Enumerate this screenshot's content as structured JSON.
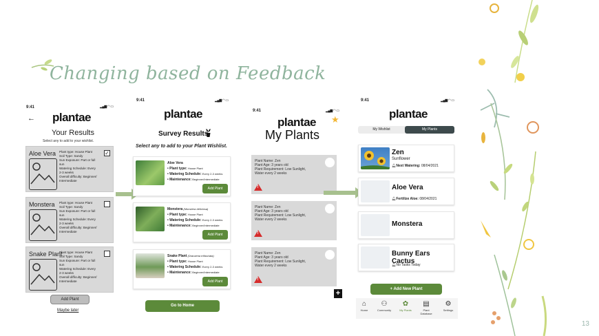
{
  "slide": {
    "title": "Changing based on Feedback",
    "page_number": "13"
  },
  "screen1": {
    "time": "9:41",
    "logo": "plantae",
    "heading": "Your Results",
    "subheading": "Select any to add to your wishlist.",
    "cards": [
      {
        "name": "Aloe Vera",
        "lines": [
          "Plant type: House Plant",
          "Soil Type: Sandy",
          "Sun Exposure: Part or full",
          "sun",
          "Watering Schedule: Every",
          "2-3 weeks",
          "Overall difficulty: Beginner/",
          "Intermediate"
        ],
        "checked": "✓"
      },
      {
        "name": "Monstera",
        "lines": [
          "Plant type: House Plant",
          "Soil Type: Sandy",
          "Sun Exposure: Part or full",
          "sun",
          "Watering Schedule: Every",
          "2-3 weeks",
          "Overall difficulty: Beginner/",
          "Intermediate"
        ],
        "checked": ""
      },
      {
        "name": "Snake Plant",
        "lines": [
          "Plant type: House Plant",
          "Soil Type: Sandy",
          "Sun Exposure: Part or full",
          "sun",
          "Watering Schedule: Every",
          "2-3 weeks",
          "Overall difficulty: Beginner/",
          "Intermediate"
        ],
        "checked": ""
      }
    ],
    "add_button": "Add Plant",
    "later_link": "Maybe later"
  },
  "screen2": {
    "time": "9:41",
    "logo": "plantae",
    "heading": "Survey Results",
    "subheading": "Select any to add to your Plant Wishlist.",
    "cards": [
      {
        "name": "Aloe Vera",
        "sci": "",
        "type": "House Plant",
        "schedule": "Every 2-3 weeks",
        "maint": "Beginner/Intermediate",
        "button": "Add Plant"
      },
      {
        "name": "Monstera",
        "sci": "(Monstera deliciosa)",
        "type": "House Plant",
        "schedule": "Every 2-3 weeks",
        "maint": "Beginner/Intermediate",
        "button": "Add Plant"
      },
      {
        "name": "Snake Plant",
        "sci": "(Dracaena trifasciata)",
        "type": "House Plant",
        "schedule": "Every 2-3 weeks",
        "maint": "Beginner/Intermediate",
        "button": "Add Plant"
      }
    ],
    "labels": {
      "type": "• Plant type:",
      "schedule": "• Watering Schedule:",
      "maint": "• Maintenance:"
    },
    "home_button": "Go to Home"
  },
  "screen3": {
    "time": "9:41",
    "logo": "plantae",
    "heading": "My Plants",
    "plus": "+",
    "cards": [
      {
        "lines": [
          "Plant Name: Zen",
          "Plant Age: 3 years old",
          "Plant Requirement: Low Sunlight,",
          "Water every 2 weeks"
        ]
      },
      {
        "lines": [
          "Plant Name: Zen",
          "Plant Age: 3 years old",
          "Plant Requirement: Low Sunlight,",
          "Water every 2 weeks"
        ]
      },
      {
        "lines": [
          "Plant Name: Zen",
          "Plant Age: 3 years old",
          "Plant Requirement: Low Sunlight,",
          "Water every 2 weeks"
        ]
      }
    ]
  },
  "screen4": {
    "time": "9:41",
    "logo": "plantae",
    "tabs": [
      "My Wishlist",
      "My Plants"
    ],
    "cards": [
      {
        "name": "Zen",
        "sub": "Sunflower",
        "note_label": "Next Watering:",
        "note_value": " 08/04/2021"
      },
      {
        "name": "Aloe Vera",
        "sub": "",
        "note_label": "Fertilize Aloe:",
        "note_value": " 08/04/2021"
      },
      {
        "name": "Monstera",
        "sub": "",
        "note_label": "",
        "note_value": ""
      },
      {
        "name": "Bunny Ears Cactus",
        "sub": "",
        "note_label": "",
        "note_value": "No Tasks Today"
      }
    ],
    "add_button": "+ Add New Plant",
    "nav": [
      "Home",
      "Community",
      "My Plants",
      "Plant Database",
      "Settings"
    ]
  },
  "colors": {
    "accent_green": "#5c8a3a",
    "arrow_green": "#a7c08e",
    "title_green": "#8fb49d",
    "alert_red": "#d62b2b",
    "tab_active": "#3d4a4c"
  }
}
